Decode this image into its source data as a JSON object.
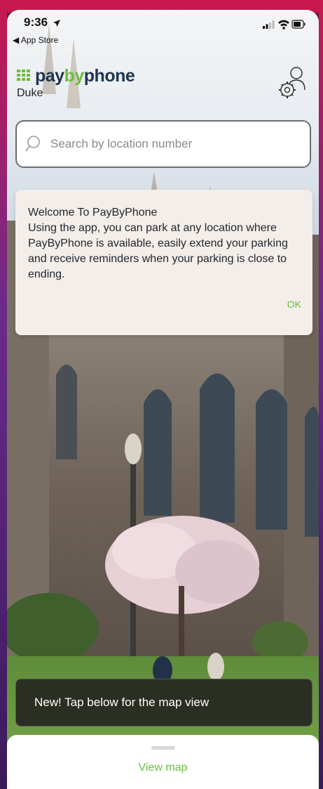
{
  "status_bar": {
    "time": "9:36",
    "back_label": "◀ App Store"
  },
  "brand": {
    "pay": "pay",
    "by": "by",
    "phone": "phone",
    "subtitle": "Duke"
  },
  "search": {
    "placeholder": "Search by location number",
    "value": ""
  },
  "welcome": {
    "title": "Welcome To PayByPhone",
    "body": "Using the app, you can park at any location where PayByPhone is available, easily extend your parking and receive reminders when your parking is close to ending.",
    "ok_label": "OK"
  },
  "banner": {
    "text": "New! Tap below for the map view"
  },
  "sheet": {
    "view_map_label": "View map"
  },
  "colors": {
    "brand_green": "#6bbd3b",
    "brand_navy": "#1d3550",
    "frame_magenta": "#c8184f"
  },
  "icons": [
    "location-arrow-icon",
    "signal-icon",
    "wifi-icon",
    "battery-icon",
    "grid-logo-icon",
    "account-settings-icon",
    "search-icon"
  ]
}
